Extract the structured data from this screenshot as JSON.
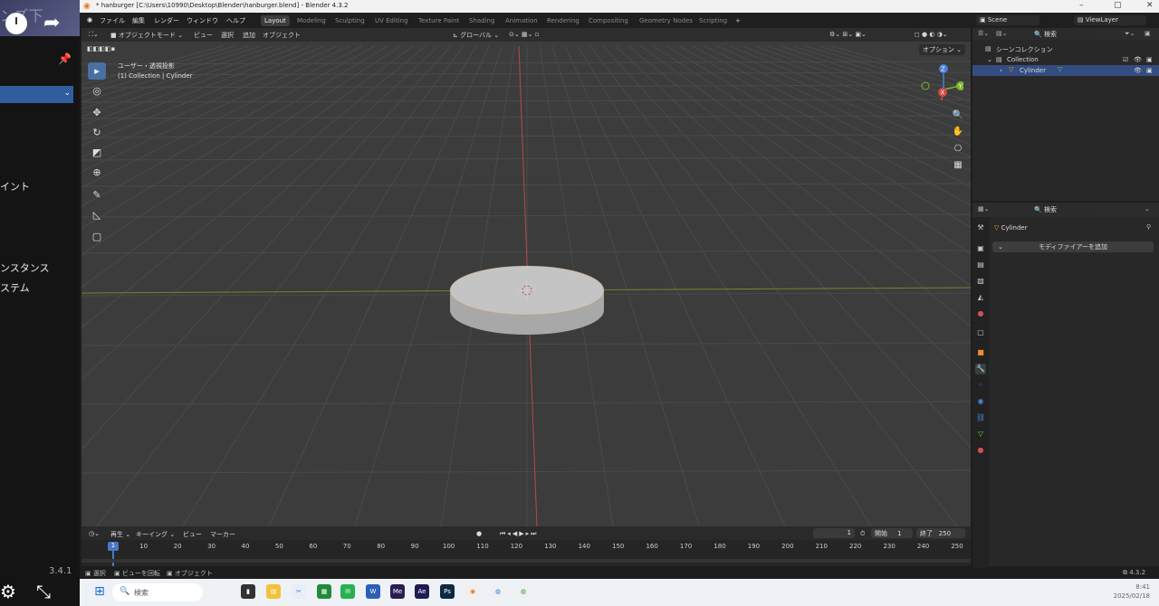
{
  "left_panel": {
    "ghost_title": "ンズ下",
    "items": [
      "イント",
      "ンスタンス",
      "ステム"
    ],
    "version": "3.4.1"
  },
  "titlebar": {
    "title": "* hanburger [C:\\Users\\10990\\Desktop\\Blender\\hanburger.blend] - Blender 4.3.2",
    "min": "–",
    "max": "▢",
    "close": "✕"
  },
  "menubar": {
    "menus": [
      "ファイル",
      "編集",
      "レンダー",
      "ウィンドウ",
      "ヘルプ"
    ],
    "workspaces": [
      "Layout",
      "Modeling",
      "Sculpting",
      "UV Editing",
      "Texture Paint",
      "Shading",
      "Animation",
      "Rendering",
      "Compositing",
      "Geometry Nodes",
      "Scripting"
    ],
    "add_tab": "+",
    "scene": "Scene",
    "view_layer": "ViewLayer"
  },
  "viewport": {
    "mode": "オブジェクトモード",
    "menus": [
      "ビュー",
      "選択",
      "追加",
      "オブジェクト"
    ],
    "transform": "グローバル",
    "info_line1": "ユーザー・透視投影",
    "info_line2": "(1) Collection | Cylinder",
    "option": "オプション"
  },
  "axis_gizmo": {
    "x": "X",
    "y": "Y",
    "z": "Z"
  },
  "timeline": {
    "menus": [
      "再生",
      "キーイング",
      "ビュー",
      "マーカー"
    ],
    "current_frame": "1",
    "start_label": "開始",
    "start": "1",
    "end_label": "終了",
    "end": "250",
    "ticks": [
      "1",
      "10",
      "20",
      "30",
      "40",
      "50",
      "60",
      "70",
      "80",
      "90",
      "100",
      "110",
      "120",
      "130",
      "140",
      "150",
      "160",
      "170",
      "180",
      "190",
      "200",
      "210",
      "220",
      "230",
      "240",
      "250"
    ]
  },
  "statusbar": {
    "items": [
      "選択",
      "ビューを回転",
      "オブジェクト"
    ],
    "version": "4.3.2"
  },
  "outliner": {
    "search_placeholder": "検索",
    "root": "シーンコレクション",
    "collection": "Collection",
    "object": "Cylinder"
  },
  "properties": {
    "search_placeholder": "検索",
    "object_name": "Cylinder",
    "add_modifier": "モディファイアーを追加"
  },
  "taskbar": {
    "search": "検索",
    "apps": [
      {
        "label": "Me",
        "color": "#2b1d52"
      },
      {
        "label": "Ae",
        "color": "#1f1b52"
      },
      {
        "label": "Ps",
        "color": "#0d2a44"
      }
    ],
    "time": "8:41",
    "date": "2025/02/18"
  }
}
